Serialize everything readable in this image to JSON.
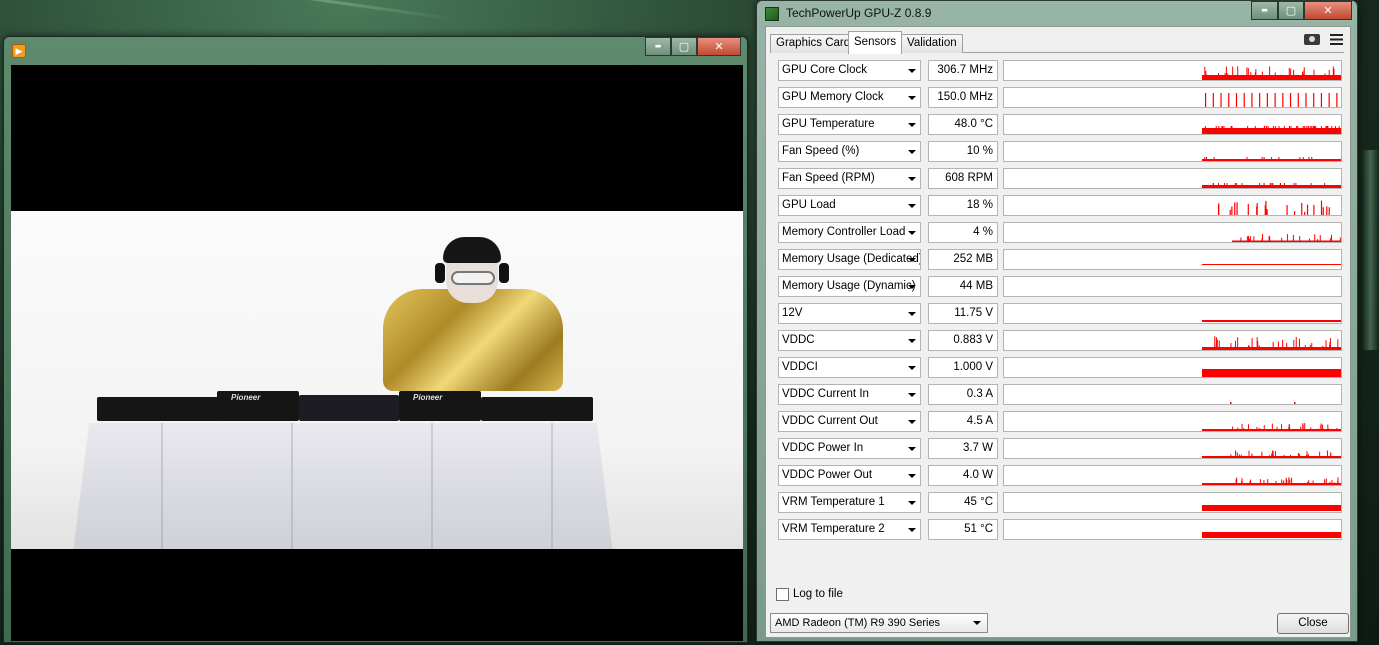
{
  "video_window": {
    "buttons": {
      "minimize": "▬",
      "maximize": "▢",
      "close": "✕"
    },
    "brand_text": [
      "Pioneer",
      "Pioneer"
    ]
  },
  "gpuz": {
    "title": "TechPowerUp GPU-Z 0.8.9",
    "window_buttons": {
      "minimize": "▬",
      "maximize": "▢",
      "close": "✕"
    },
    "tabs": [
      {
        "label": "Graphics Card",
        "active": false
      },
      {
        "label": "Sensors",
        "active": true
      },
      {
        "label": "Validation",
        "active": false
      }
    ],
    "graph_color": "#ff0000",
    "sensors": [
      {
        "name": "GPU Core Clock",
        "value": "306.7 MHz",
        "graph": "spiky_low"
      },
      {
        "name": "GPU Memory Clock",
        "value": "150.0 MHz",
        "graph": "sparse_tall"
      },
      {
        "name": "GPU Temperature",
        "value": "48.0 °C",
        "graph": "band_mid"
      },
      {
        "name": "Fan Speed (%)",
        "value": "10 %",
        "graph": "thin_low"
      },
      {
        "name": "Fan Speed (RPM)",
        "value": "608 RPM",
        "graph": "band_low"
      },
      {
        "name": "GPU Load",
        "value": "18 %",
        "graph": "sparse_mixed"
      },
      {
        "name": "Memory Controller Load",
        "value": "4 %",
        "graph": "sparse_small"
      },
      {
        "name": "Memory Usage (Dedicated)",
        "value": "252 MB",
        "graph": "flat_line"
      },
      {
        "name": "Memory Usage (Dynamic)",
        "value": "44 MB",
        "graph": "none"
      },
      {
        "name": "12V",
        "value": "11.75 V",
        "graph": "flat_line_thick"
      },
      {
        "name": "VDDC",
        "value": "0.883 V",
        "graph": "spiky_mid"
      },
      {
        "name": "VDDCI",
        "value": "1.000 V",
        "graph": "full_block"
      },
      {
        "name": "VDDC Current In",
        "value": "0.3 A",
        "graph": "dots"
      },
      {
        "name": "VDDC Current Out",
        "value": "4.5 A",
        "graph": "thin_spiky"
      },
      {
        "name": "VDDC Power In",
        "value": "3.7 W",
        "graph": "thin_spiky"
      },
      {
        "name": "VDDC Power Out",
        "value": "4.0 W",
        "graph": "thin_spiky"
      },
      {
        "name": "VRM Temperature 1",
        "value": "45 °C",
        "graph": "band_thick"
      },
      {
        "name": "VRM Temperature 2",
        "value": "51 °C",
        "graph": "band_thick"
      }
    ],
    "log_to_file": {
      "label": "Log to file",
      "checked": false
    },
    "gpu_select": {
      "value": "AMD Radeon (TM) R9 390 Series"
    },
    "close_label": "Close"
  }
}
